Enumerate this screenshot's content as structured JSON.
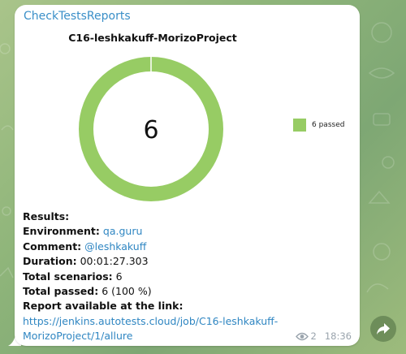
{
  "message": {
    "sender": "CheckTestsReports",
    "views": "2",
    "time": "18:36"
  },
  "chart_data": {
    "type": "pie",
    "title": "C16-leshkakuff-MorizoProject",
    "categories": [
      "passed"
    ],
    "values": [
      6
    ],
    "center_label": "6",
    "legend": [
      {
        "label": "6 passed",
        "color": "#97cc64"
      }
    ],
    "legend_position": "right",
    "colors": {
      "passed": "#97cc64"
    }
  },
  "report": {
    "results_label": "Results:",
    "environment_label": "Environment:",
    "environment_value": "qa.guru",
    "comment_label": "Comment:",
    "comment_value": "@leshkakuff",
    "duration_label": "Duration:",
    "duration_value": "00:01:27.303",
    "total_scenarios_label": "Total scenarios:",
    "total_scenarios_value": "6",
    "total_passed_label": "Total passed:",
    "total_passed_value": "6 (100 %)",
    "link_label": "Report available at the link:",
    "link_url": "https://jenkins.autotests.cloud/job/C16-leshkakuff-MorizoProject/1/allure"
  },
  "theme": {
    "accent": "#3a8fc8",
    "link": "#2f86c2",
    "meta": "#9aa4ad"
  }
}
